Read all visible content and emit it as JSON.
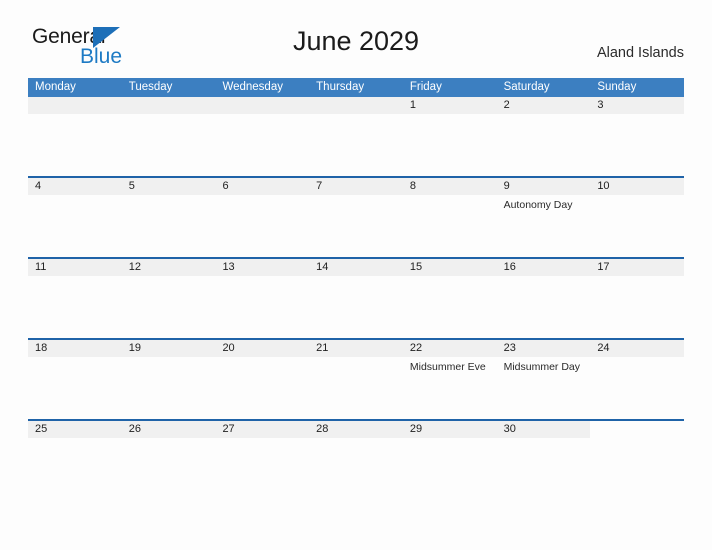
{
  "brand": {
    "name_top": "General",
    "name_bottom": "Blue",
    "triangle_color": "#1d6fb8",
    "blue_color": "#1d7ac4"
  },
  "header": {
    "title": "June 2029",
    "region": "Aland Islands"
  },
  "colors": {
    "header_blue": "#3c7fc1",
    "row_divider": "#1f63a8",
    "date_band": "#f0f0f0",
    "page_background": "#fdfdfd"
  },
  "calendar": {
    "weekdays": [
      "Monday",
      "Tuesday",
      "Wednesday",
      "Thursday",
      "Friday",
      "Saturday",
      "Sunday"
    ],
    "weeks": [
      [
        {
          "date": "",
          "events": []
        },
        {
          "date": "",
          "events": []
        },
        {
          "date": "",
          "events": []
        },
        {
          "date": "",
          "events": []
        },
        {
          "date": "1",
          "events": []
        },
        {
          "date": "2",
          "events": []
        },
        {
          "date": "3",
          "events": []
        }
      ],
      [
        {
          "date": "4",
          "events": []
        },
        {
          "date": "5",
          "events": []
        },
        {
          "date": "6",
          "events": []
        },
        {
          "date": "7",
          "events": []
        },
        {
          "date": "8",
          "events": []
        },
        {
          "date": "9",
          "events": [
            "Autonomy Day"
          ]
        },
        {
          "date": "10",
          "events": []
        }
      ],
      [
        {
          "date": "11",
          "events": []
        },
        {
          "date": "12",
          "events": []
        },
        {
          "date": "13",
          "events": []
        },
        {
          "date": "14",
          "events": []
        },
        {
          "date": "15",
          "events": []
        },
        {
          "date": "16",
          "events": []
        },
        {
          "date": "17",
          "events": []
        }
      ],
      [
        {
          "date": "18",
          "events": []
        },
        {
          "date": "19",
          "events": []
        },
        {
          "date": "20",
          "events": []
        },
        {
          "date": "21",
          "events": []
        },
        {
          "date": "22",
          "events": [
            "Midsummer Eve"
          ]
        },
        {
          "date": "23",
          "events": [
            "Midsummer Day"
          ]
        },
        {
          "date": "24",
          "events": []
        }
      ],
      [
        {
          "date": "25",
          "events": []
        },
        {
          "date": "26",
          "events": []
        },
        {
          "date": "27",
          "events": []
        },
        {
          "date": "28",
          "events": []
        },
        {
          "date": "29",
          "events": []
        },
        {
          "date": "30",
          "events": []
        },
        {
          "date": "",
          "events": []
        }
      ]
    ]
  }
}
